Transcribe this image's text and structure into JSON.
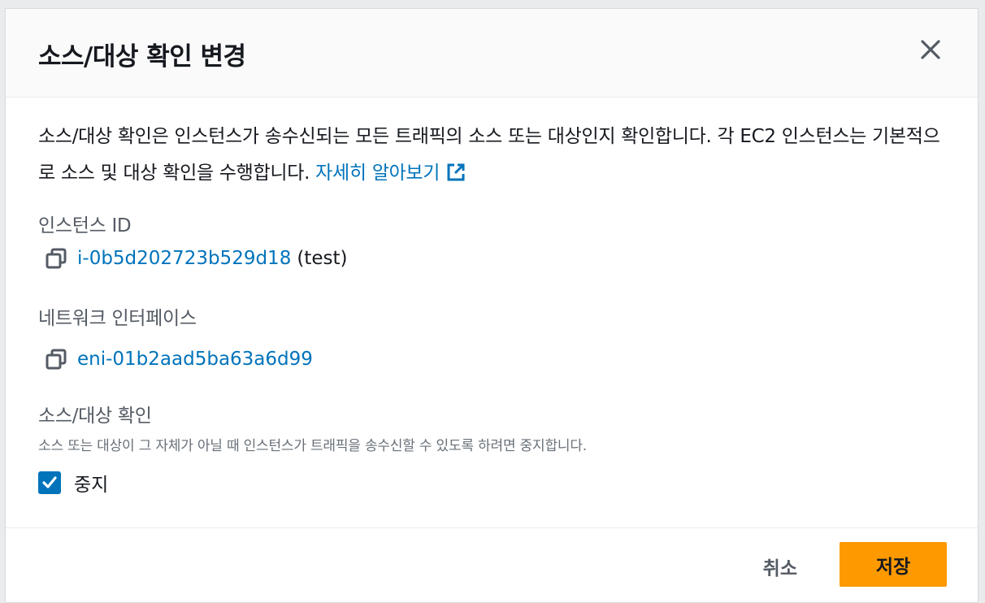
{
  "modal": {
    "title": "소스/대상 확인 변경",
    "description": "소스/대상 확인은 인스턴스가 송수신되는 모든 트래픽의 소스 또는 대상인지 확인합니다. 각 EC2 인스턴스는 기본적으로 소스 및 대상 확인을 수행합니다.",
    "learn_more": "자세히 알아보기"
  },
  "instance": {
    "label": "인스턴스 ID",
    "id": "i-0b5d202723b529d18",
    "name": "(test)"
  },
  "network_interface": {
    "label": "네트워크 인터페이스",
    "id": "eni-01b2aad5ba63a6d99"
  },
  "source_dest_check": {
    "label": "소스/대상 확인",
    "description": "소스 또는 대상이 그 자체가 아닐 때 인스턴스가 트래픽을 송수신할 수 있도록 하려면 중지합니다.",
    "checkbox_label": "중지",
    "checked": true
  },
  "footer": {
    "cancel_label": "취소",
    "save_label": "저장"
  },
  "colors": {
    "link": "#0073bb",
    "primary_button": "#ff9900",
    "checkbox": "#0073bb"
  }
}
